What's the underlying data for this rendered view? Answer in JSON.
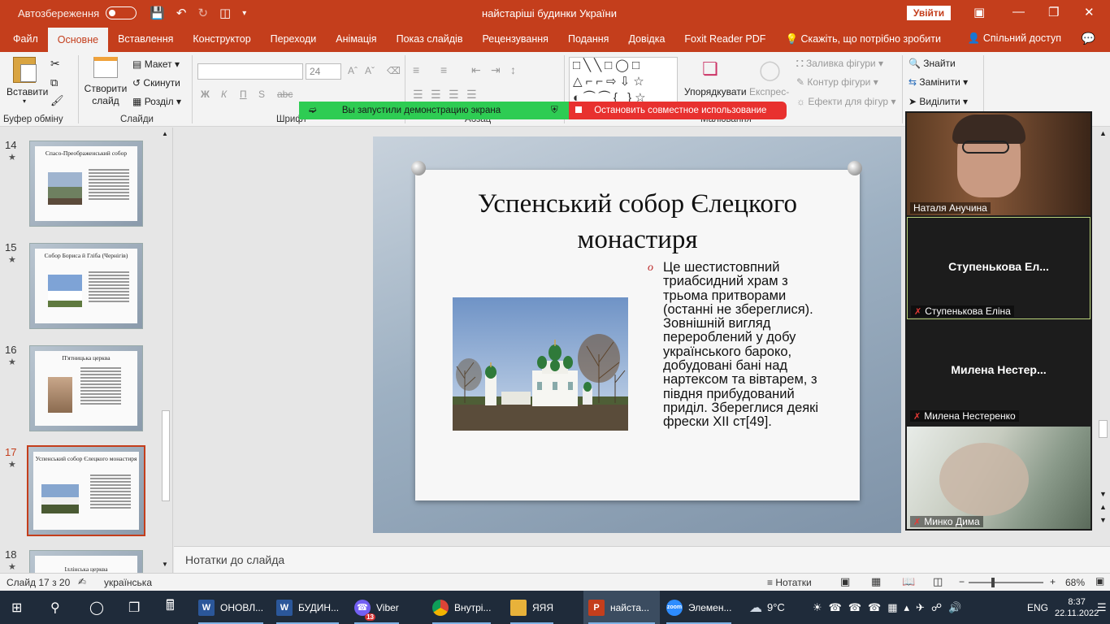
{
  "titlebar": {
    "autosave_label": "Автозбереження",
    "document_title": "найстаріші будинки України",
    "signin_label": "Увійти"
  },
  "tabs": [
    {
      "label": "Файл"
    },
    {
      "label": "Основне",
      "active": true
    },
    {
      "label": "Вставлення"
    },
    {
      "label": "Конструктор"
    },
    {
      "label": "Переходи"
    },
    {
      "label": "Анімація"
    },
    {
      "label": "Показ слайдів"
    },
    {
      "label": "Рецензування"
    },
    {
      "label": "Подання"
    },
    {
      "label": "Довідка"
    },
    {
      "label": "Foxit Reader PDF"
    },
    {
      "label": "Скажіть, що потрібно зробити"
    }
  ],
  "share_label": "Спільний доступ",
  "ribbon": {
    "paste_label": "Вставити",
    "clipboard_group": "Буфер обміну",
    "new_slide_label": "Створити слайд",
    "layout_label": "Макет",
    "reset_label": "Скинути",
    "section_label": "Розділ",
    "slides_group": "Слайди",
    "font_size": "24",
    "font_group": "Шрифт",
    "paragraph_group": "Абзац",
    "arrange_label": "Упорядкувати",
    "quick_styles_label": "Експрес-",
    "shape_fill_label": "Заливка фігури",
    "shape_outline_label": "Контур фігури",
    "shape_effects_label": "Ефекти для фігур",
    "drawing_group": "Малювання",
    "find_label": "Знайти",
    "replace_label": "Замінити",
    "select_label": "Виділити"
  },
  "share_bar": {
    "green_text": "Вы запустили демонстрацию экрана",
    "red_text": "Остановить совместное использование"
  },
  "thumbnails": [
    {
      "num": "14",
      "title": "Спасо-Преображенський собор"
    },
    {
      "num": "15",
      "title": "Собор Бориса й Гліба (Чернігів)"
    },
    {
      "num": "16",
      "title": "П'ятницька церква"
    },
    {
      "num": "17",
      "title": "Успенський собор Єлецкого монастиря",
      "selected": true
    },
    {
      "num": "18",
      "title": "Іллінська церква"
    }
  ],
  "slide": {
    "title": "Успенський собор Єлецкого монастиря",
    "body": "Це шестистовпний триабсидний храм з трьома притворами (останні не збереглися). Зовнішній вигляд перероблений у добу українського бароко, добудовані бані над нартексом та вівтарем, з півдня прибудований приділ. Збереглися деякі фрески XII ст[49]."
  },
  "notes_placeholder": "Нотатки до слайда",
  "video_tiles": [
    {
      "label": "Наталя Анучина",
      "name": ""
    },
    {
      "label": "Ступенькова Еліна",
      "name": "Ступенькова  Ел..."
    },
    {
      "label": "Милена Нестеренко",
      "name": "Милена  Нестер..."
    },
    {
      "label": "Минко Дима",
      "name": ""
    }
  ],
  "statusbar": {
    "slide_info": "Слайд 17 з 20",
    "language": "українська",
    "notes_label": "Нотатки",
    "zoom": "68%"
  },
  "taskbar": {
    "items": [
      {
        "label": "ОНОВЛ..."
      },
      {
        "label": "БУДИН..."
      },
      {
        "label": "Viber",
        "badge": "13"
      },
      {
        "label": "Внутрі..."
      },
      {
        "label": "ЯЯЯ"
      },
      {
        "label": "найста..."
      },
      {
        "label": "Элемен..."
      }
    ],
    "weather": "9°C",
    "language": "ENG",
    "time": "8:37",
    "date": "22.11.2022"
  }
}
